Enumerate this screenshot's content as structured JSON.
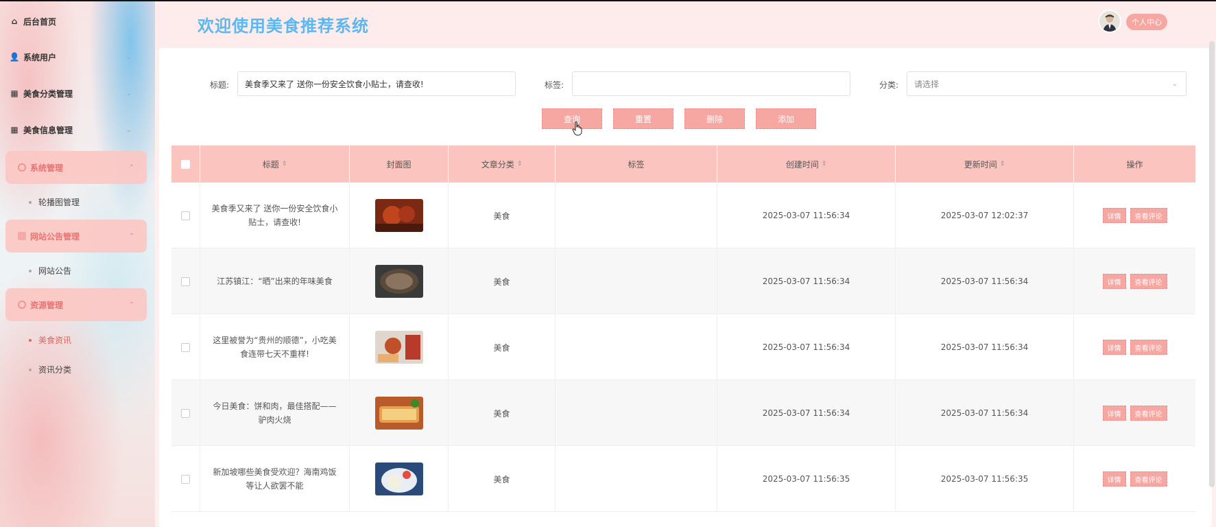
{
  "sidebar": {
    "items": [
      {
        "label": "后台首页",
        "icon": "home-icon"
      },
      {
        "label": "系统用户",
        "icon": "user-icon"
      },
      {
        "label": "美食分类管理",
        "icon": "grid-icon"
      },
      {
        "label": "美食信息管理",
        "icon": "grid-icon"
      }
    ],
    "groups": [
      {
        "label": "系统管理",
        "children": [
          "轮播图管理"
        ]
      },
      {
        "label": "网站公告管理",
        "children": [
          "网站公告"
        ]
      },
      {
        "label": "资源管理",
        "children": [
          "美食资讯",
          "资讯分类"
        ]
      }
    ]
  },
  "header": {
    "title": "欢迎使用美食推荐系统",
    "user_label": "个人中心"
  },
  "search": {
    "title_label": "标题:",
    "title_value": "美食季又来了 送你一份安全饮食小贴士，请查收!",
    "tag_label": "标签:",
    "tag_value": "",
    "category_label": "分类:",
    "category_placeholder": "请选择"
  },
  "buttons": {
    "query": "查询",
    "reset": "重置",
    "delete": "删除",
    "add": "添加"
  },
  "table": {
    "columns": [
      "标题",
      "封面图",
      "文章分类",
      "标签",
      "创建时间",
      "更新时间",
      "操作"
    ],
    "rows": [
      {
        "title": "美食季又来了 送你一份安全饮食小贴士，请查收!",
        "category": "美食",
        "tags": "",
        "created": "2025-03-07 11:56:34",
        "updated": "2025-03-07 12:02:37"
      },
      {
        "title": "江苏镇江：“晒”出来的年味美食",
        "category": "美食",
        "tags": "",
        "created": "2025-03-07 11:56:34",
        "updated": "2025-03-07 11:56:34"
      },
      {
        "title": "这里被誉为“贵州的顺德”，小吃美食连带七天不重样!",
        "category": "美食",
        "tags": "",
        "created": "2025-03-07 11:56:34",
        "updated": "2025-03-07 11:56:34"
      },
      {
        "title": "今日美食：饼和肉，最佳搭配——驴肉火烧",
        "category": "美食",
        "tags": "",
        "created": "2025-03-07 11:56:34",
        "updated": "2025-03-07 11:56:34"
      },
      {
        "title": "新加坡哪些美食受欢迎？海南鸡饭等让人欲罢不能",
        "category": "美食",
        "tags": "",
        "created": "2025-03-07 11:56:35",
        "updated": "2025-03-07 11:56:35"
      }
    ],
    "row_actions": {
      "detail": "详情",
      "comments": "查看评论"
    }
  },
  "colors": {
    "accent": "#f6a7a1",
    "title": "#5cb8ee",
    "header_row": "#fbc4bf"
  }
}
